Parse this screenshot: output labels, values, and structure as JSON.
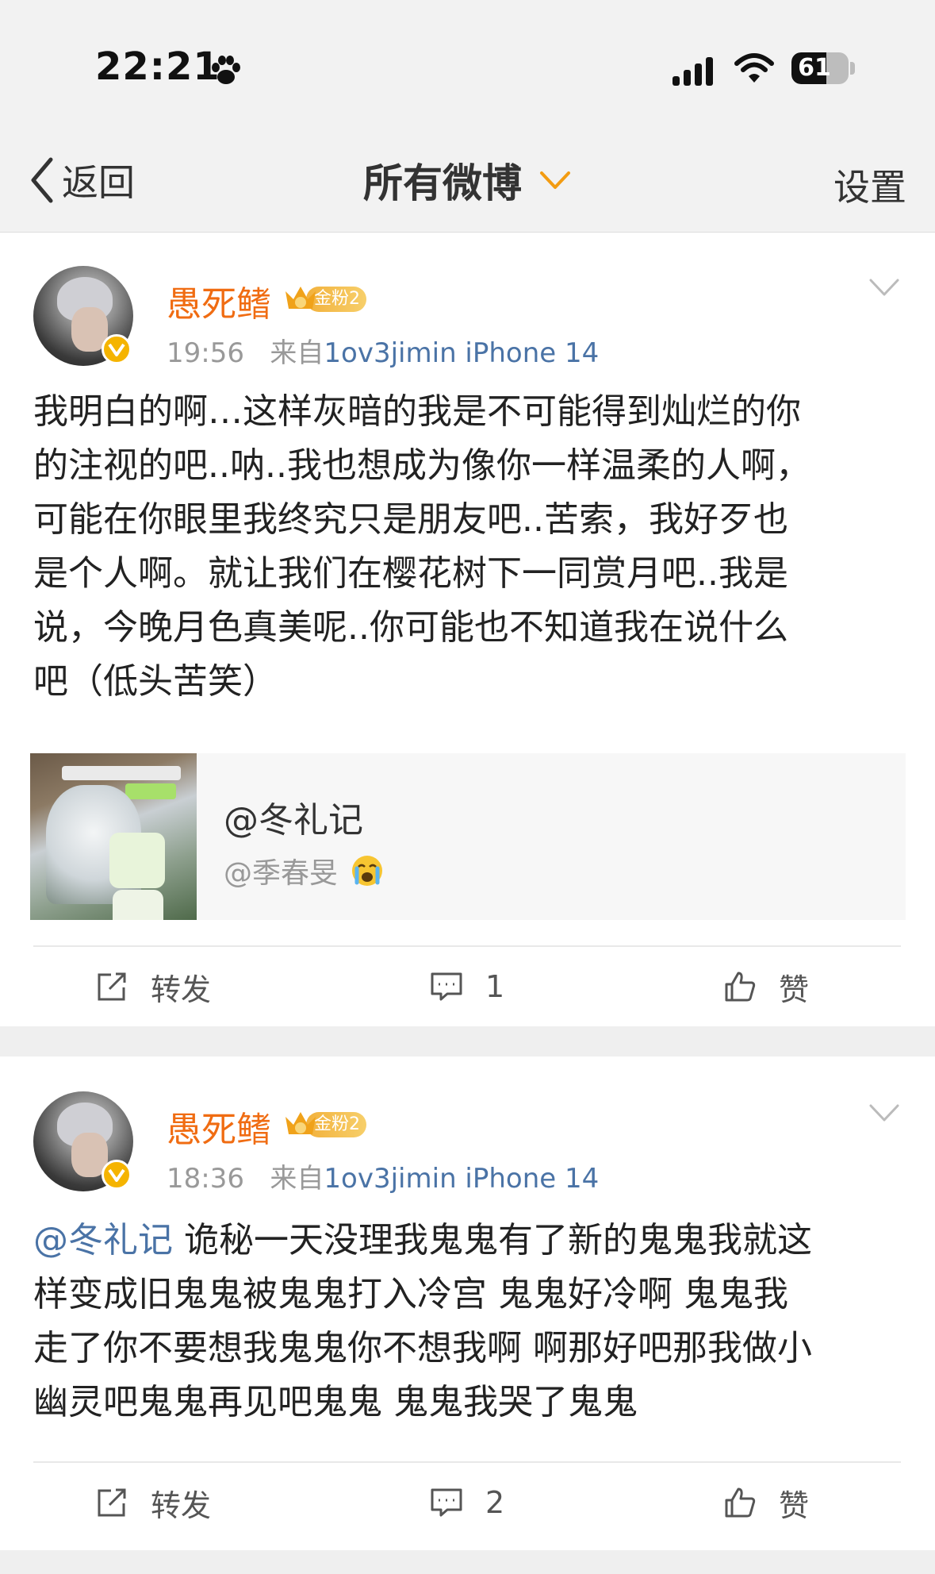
{
  "status_bar": {
    "time": "22:21",
    "battery": "61",
    "battery_level": 0.61
  },
  "nav": {
    "back_label": "返回",
    "title": "所有微博",
    "settings_label": "设置"
  },
  "posts": [
    {
      "username": "愚死鳍",
      "fan_badge": "金粉2",
      "time": "19:56",
      "source_prefix": "来自",
      "source": "1ov3jimin iPhone 14",
      "text": "我明白的啊…这样灰暗的我是不可能得到灿烂的你\n的注视的吧..呐..我也想成为像你一样温柔的人啊，\n可能在你眼里我终究只是朋友吧..苦索，我好歹也\n是个人啊。就让我们在樱花树下一同赏月吧..我是\n说，今晚月色真美呢..你可能也不知道我在说什么\n吧（低头苦笑）",
      "repost": {
        "name": "@冬礼记",
        "sub": "@季春旻"
      },
      "actions": {
        "forward": "转发",
        "comments": "1",
        "like": "赞"
      }
    },
    {
      "username": "愚死鳍",
      "fan_badge": "金粉2",
      "time": "18:36",
      "source_prefix": "来自",
      "source": "1ov3jimin iPhone 14",
      "mention": "@冬礼记",
      "text": " 诡秘一天没理我鬼鬼有了新的鬼鬼我就这\n样变成旧鬼鬼被鬼鬼打入冷宫 鬼鬼好冷啊 鬼鬼我\n走了你不要想我鬼鬼你不想我啊 啊那好吧那我做小\n幽灵吧鬼鬼再见吧鬼鬼 鬼鬼我哭了鬼鬼",
      "actions": {
        "forward": "转发",
        "comments": "2",
        "like": "赞"
      }
    }
  ],
  "colors": {
    "username": "#f06c12",
    "link": "#4a73a6",
    "badge_gold": "#f5b400"
  },
  "icons": [
    "paw-icon",
    "signal-icon",
    "wifi-icon",
    "chevron-left-icon",
    "chevron-down-icon",
    "verified-icon",
    "crown-icon",
    "crying-emoji-icon",
    "forward-icon",
    "comment-icon",
    "like-icon"
  ]
}
